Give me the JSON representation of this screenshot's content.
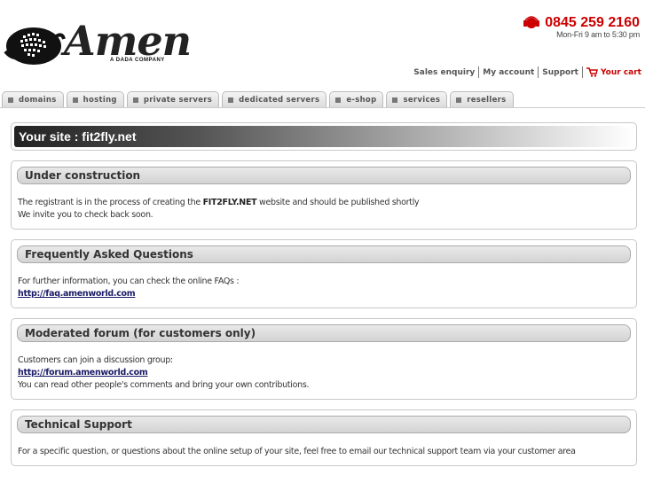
{
  "header": {
    "logo_text": "Amen",
    "logo_sub": "A DADA COMPANY",
    "phone_number": "0845 259 2160",
    "phone_hours": "Mon-Fri 9 am to 5:30 pm",
    "nav": [
      {
        "label": "Sales enquiry"
      },
      {
        "label": "My account"
      },
      {
        "label": "Support"
      },
      {
        "label": "Your cart"
      }
    ]
  },
  "tabs": [
    {
      "label": "domains"
    },
    {
      "label": "hosting"
    },
    {
      "label": "private servers"
    },
    {
      "label": "dedicated servers"
    },
    {
      "label": "e-shop"
    },
    {
      "label": "services"
    },
    {
      "label": "resellers"
    }
  ],
  "main": {
    "site_title": "Your site : fit2fly.net",
    "sections": [
      {
        "heading": "Under construction",
        "line1_prefix": "The registrant is in the process of creating the ",
        "line1_bold": "FIT2FLY.NET",
        "line1_suffix": " website and should be published shortly",
        "line2": "We invite you to check back soon."
      },
      {
        "heading": "Frequently Asked Questions",
        "line1": "For further information, you can check the online FAQs :",
        "link": "http://faq.amenworld.com"
      },
      {
        "heading": "Moderated forum (for customers only)",
        "line1": "Customers can join a discussion group:",
        "link": "http://forum.amenworld.com",
        "line2": "You can read other people's comments and bring your own contributions."
      },
      {
        "heading": "Technical Support",
        "line1": "For a specific question, or questions about the online setup of your site, feel free to email our technical support team via your customer area"
      }
    ]
  },
  "colors": {
    "accent_red": "#cc0000",
    "link": "#1a1a66"
  },
  "icons": {
    "logo": "globe-ball-icon",
    "phone": "headset-icon",
    "cart": "cart-icon",
    "tab_bullet": "square-bullet-icon"
  }
}
